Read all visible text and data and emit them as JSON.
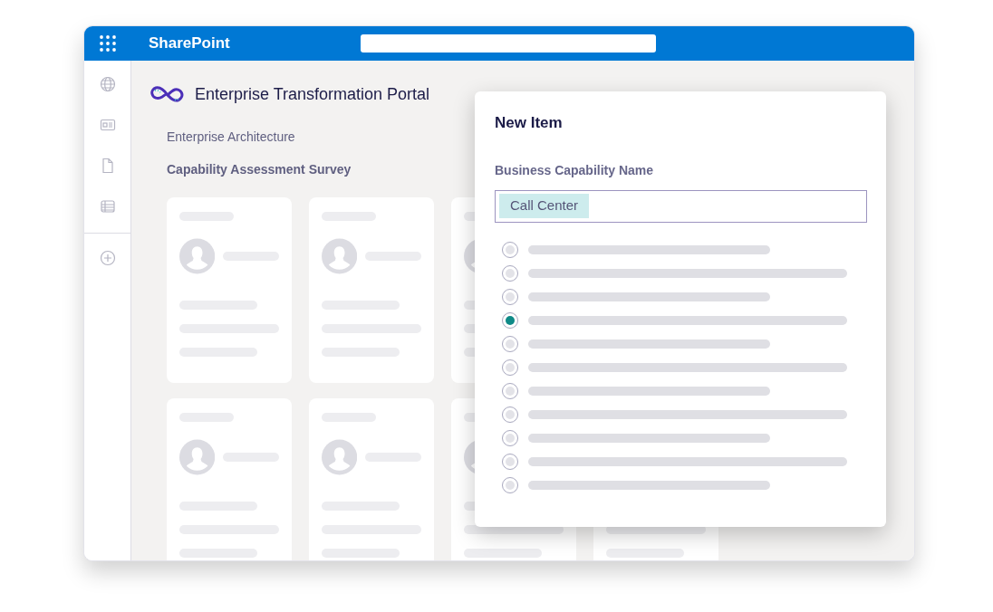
{
  "app_bar": {
    "title": "SharePoint"
  },
  "site": {
    "title": "Enterprise Transformation Portal",
    "section": "Enterprise Architecture",
    "page_title": "Capability Assessment Survey"
  },
  "dialog": {
    "title": "New Item",
    "field_label": "Business Capability Name",
    "field_value": "Call Center",
    "options": [
      {
        "selected": false
      },
      {
        "selected": false
      },
      {
        "selected": false
      },
      {
        "selected": true
      },
      {
        "selected": false
      },
      {
        "selected": false
      },
      {
        "selected": false
      },
      {
        "selected": false
      },
      {
        "selected": false
      },
      {
        "selected": false
      },
      {
        "selected": false
      }
    ]
  }
}
